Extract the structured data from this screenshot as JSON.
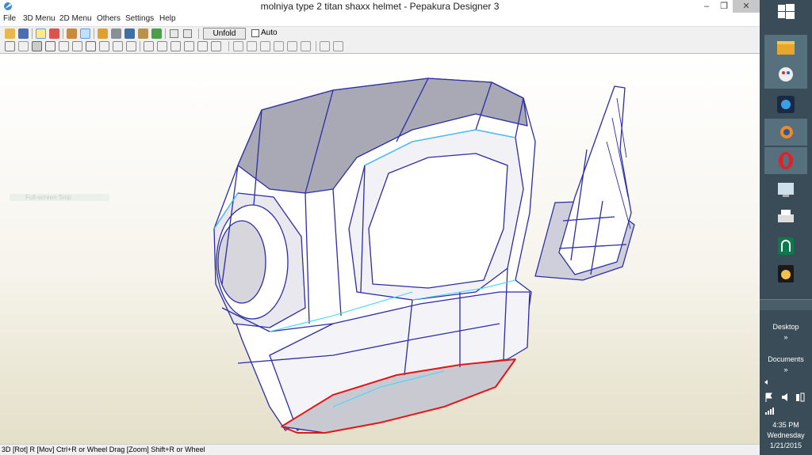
{
  "window": {
    "title": "molniya type 2 titan shaxx helmet  - Pepakura Designer 3",
    "controls": {
      "minimize": "–",
      "maximize": "❐",
      "close": "✕"
    }
  },
  "menu": [
    "File",
    "3D Menu",
    "2D Menu",
    "Others",
    "Settings",
    "Help"
  ],
  "toolbar": {
    "unfold_label": "Unfold",
    "auto_label": "Auto",
    "auto_checked": false
  },
  "viewport": {
    "fullscreen_hint": "Full-screen Snip",
    "background": "#f6f4ec"
  },
  "status_bar": "3D [Rot] R [Mov] Ctrl+R or Wheel Drag [Zoom] Shift+R or Wheel",
  "taskbar": {
    "desktop_label": "Desktop",
    "documents_label": "Documents",
    "chevron": "»",
    "time": "4:35 PM",
    "day": "Wednesday",
    "date": "1/21/2015",
    "apps": [
      "file-explorer-icon",
      "paint-icon",
      "media-icon",
      "blender-icon",
      "opera-icon",
      "control-panel-icon",
      "printer-icon",
      "app-green-icon",
      "app-yellow-icon"
    ]
  },
  "colors": {
    "mesh_edge": "#2c2ca8",
    "seam": "#40d8ff",
    "cut_edge": "#e01818",
    "taskbar": "#3a4c57"
  }
}
